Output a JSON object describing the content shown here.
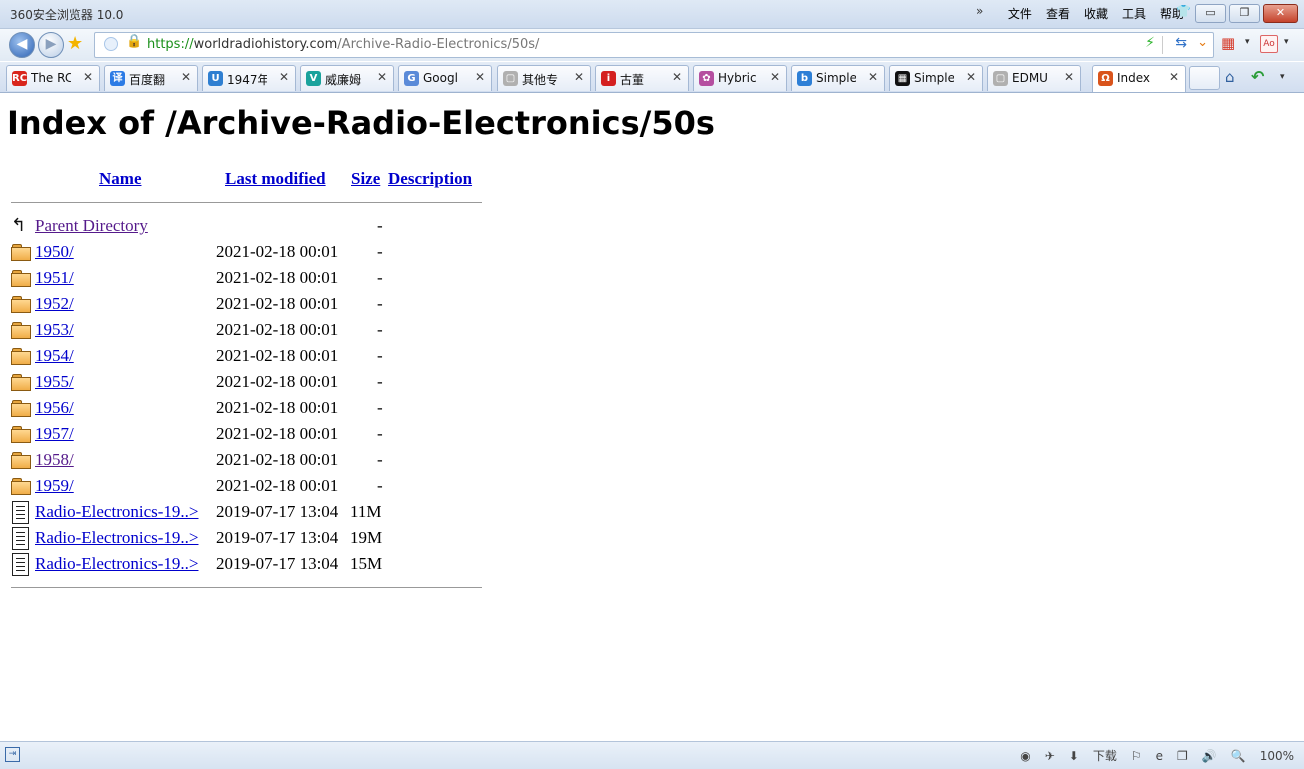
{
  "window": {
    "title": "360安全浏览器 10.0",
    "overflow_glyph": "»",
    "menu": [
      "文件",
      "查看",
      "收藏",
      "工具",
      "帮助"
    ],
    "skin_glyph": "👕",
    "min_glyph": "▭",
    "restore_glyph": "❐",
    "close_glyph": "✕"
  },
  "address": {
    "proto": "https://",
    "host": "worldradiohistory.com",
    "path": "/Archive-Radio-Electronics/50s/",
    "back_glyph": "◀",
    "fwd_glyph": "▶",
    "star_glyph": "★",
    "lock_glyph": "🔒",
    "bolt_glyph": "⚡",
    "sync_glyph": "⇆",
    "dropdown_glyph": "⌄",
    "apps_glyph": "▦",
    "pdf_label": "Ao",
    "dd_glyph": "▾"
  },
  "tabs": [
    {
      "label": "The RC",
      "icon": "RCA",
      "color": "#d9261c"
    },
    {
      "label": "百度翻",
      "icon": "译",
      "color": "#2c7be5"
    },
    {
      "label": "1947年",
      "icon": "U",
      "color": "#2f7fd1"
    },
    {
      "label": "威廉姆",
      "icon": "V",
      "color": "#1aa29c"
    },
    {
      "label": "Googl",
      "icon": "G",
      "color": "#5a8ad8"
    },
    {
      "label": "其他专",
      "icon": "▢",
      "color": "#b0b0b0"
    },
    {
      "label": "古董",
      "icon": "i",
      "color": "#d42020"
    },
    {
      "label": "Hybric",
      "icon": "✿",
      "color": "#b54fa0"
    },
    {
      "label": "Simple",
      "icon": "b",
      "color": "#2d7fd6"
    },
    {
      "label": "Simple",
      "icon": "▦",
      "color": "#111111"
    },
    {
      "label": "EDMU",
      "icon": "▢",
      "color": "#b0b0b0"
    },
    {
      "label": "Index",
      "icon": "Ω",
      "color": "#d9541c"
    }
  ],
  "tab_close_glyph": "✕",
  "toolbar_right": {
    "home_glyph": "⌂",
    "undo_glyph": "↶",
    "dd_glyph": "▾"
  },
  "page": {
    "heading": "Index of /Archive-Radio-Electronics/50s",
    "columns": {
      "name": "Name",
      "modified": "Last modified",
      "size": "Size",
      "description": "Description"
    },
    "parent": {
      "name": "Parent Directory",
      "size": "-",
      "glyph": "↰"
    },
    "entries": [
      {
        "type": "folder",
        "name": "1950/",
        "modified": "2021-02-18 00:01",
        "size": "-",
        "visited": false
      },
      {
        "type": "folder",
        "name": "1951/",
        "modified": "2021-02-18 00:01",
        "size": "-",
        "visited": false
      },
      {
        "type": "folder",
        "name": "1952/",
        "modified": "2021-02-18 00:01",
        "size": "-",
        "visited": false
      },
      {
        "type": "folder",
        "name": "1953/",
        "modified": "2021-02-18 00:01",
        "size": "-",
        "visited": false
      },
      {
        "type": "folder",
        "name": "1954/",
        "modified": "2021-02-18 00:01",
        "size": "-",
        "visited": false
      },
      {
        "type": "folder",
        "name": "1955/",
        "modified": "2021-02-18 00:01",
        "size": "-",
        "visited": false
      },
      {
        "type": "folder",
        "name": "1956/",
        "modified": "2021-02-18 00:01",
        "size": "-",
        "visited": false
      },
      {
        "type": "folder",
        "name": "1957/",
        "modified": "2021-02-18 00:01",
        "size": "-",
        "visited": false
      },
      {
        "type": "folder",
        "name": "1958/",
        "modified": "2021-02-18 00:01",
        "size": "-",
        "visited": true
      },
      {
        "type": "folder",
        "name": "1959/",
        "modified": "2021-02-18 00:01",
        "size": "-",
        "visited": false
      },
      {
        "type": "file",
        "name": "Radio-Electronics-19..>",
        "modified": "2019-07-17 13:04",
        "size": "11M",
        "visited": false
      },
      {
        "type": "file",
        "name": "Radio-Electronics-19..>",
        "modified": "2019-07-17 13:04",
        "size": "19M",
        "visited": false
      },
      {
        "type": "file",
        "name": "Radio-Electronics-19..>",
        "modified": "2019-07-17 13:04",
        "size": "15M",
        "visited": false
      }
    ]
  },
  "status": {
    "left_glyph": "⇥",
    "icons": [
      "◉",
      "✈",
      "⬇"
    ],
    "download_label": "下载",
    "more_icons": [
      "⚐",
      "e",
      "❐",
      "🔊",
      "🔍"
    ],
    "zoom": "100%"
  }
}
